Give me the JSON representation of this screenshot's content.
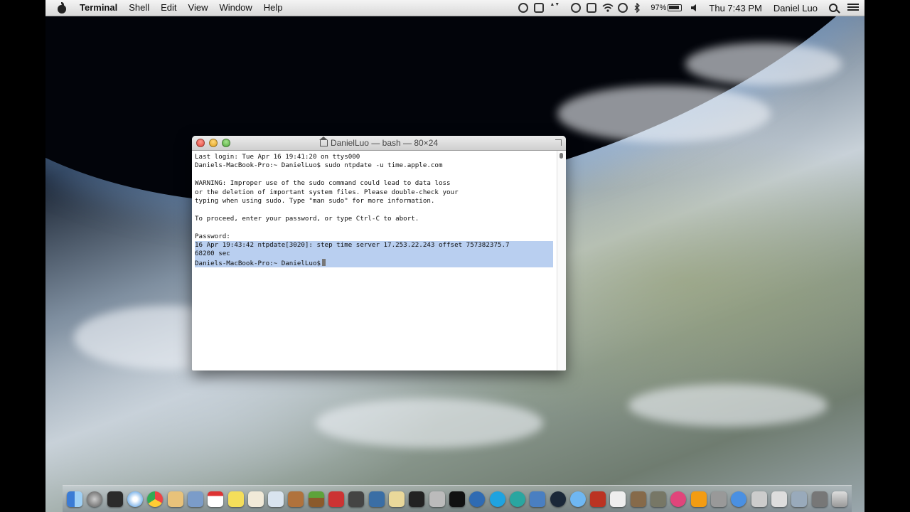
{
  "menubar": {
    "app_name": "Terminal",
    "menus": [
      "Shell",
      "Edit",
      "View",
      "Window",
      "Help"
    ],
    "battery_percent": "97%",
    "clock": "Thu 7:43 PM",
    "user": "Daniel Luo",
    "status_icons": [
      "record-icon",
      "evernote-icon",
      "network-stats-icon",
      "1password-icon",
      "airplay-icon",
      "wifi-icon",
      "time-machine-icon",
      "bluetooth-icon",
      "battery-icon",
      "volume-icon"
    ]
  },
  "terminal": {
    "title": "DanielLuo — bash — 80×24",
    "lines": [
      "Last login: Tue Apr 16 19:41:20 on ttys000",
      "Daniels-MacBook-Pro:~ DanielLuo$ sudo ntpdate -u time.apple.com",
      "",
      "WARNING: Improper use of the sudo command could lead to data loss",
      "or the deletion of important system files. Please double-check your",
      "typing when using sudo. Type \"man sudo\" for more information.",
      "",
      "To proceed, enter your password, or type Ctrl-C to abort.",
      "",
      "Password:"
    ],
    "selected_lines": [
      "16 Apr 19:43:42 ntpdate[3020]: step time server 17.253.22.243 offset 757382375.7",
      "68200 sec",
      "Daniels-MacBook-Pro:~ DanielLuo$"
    ]
  },
  "dock": {
    "items": [
      "finder",
      "launchpad",
      "mission-control",
      "safari",
      "chrome",
      "notes",
      "preview",
      "calendar",
      "stickies",
      "textedit",
      "pages",
      "guitar",
      "minecraft",
      "photo-booth",
      "camera",
      "xcode",
      "cyberduck",
      "animal",
      "system",
      "terminal",
      "quicktime",
      "skype",
      "sync",
      "virtualbox",
      "steam",
      "messages",
      "book",
      "text",
      "photos",
      "gimp",
      "itunes",
      "ibooks",
      "network",
      "downloads",
      "disk",
      "drive",
      "usb",
      "cable",
      "trash"
    ]
  },
  "colors": {
    "selection": "#b9cff0",
    "menubar_top": "#f4f4f4"
  }
}
